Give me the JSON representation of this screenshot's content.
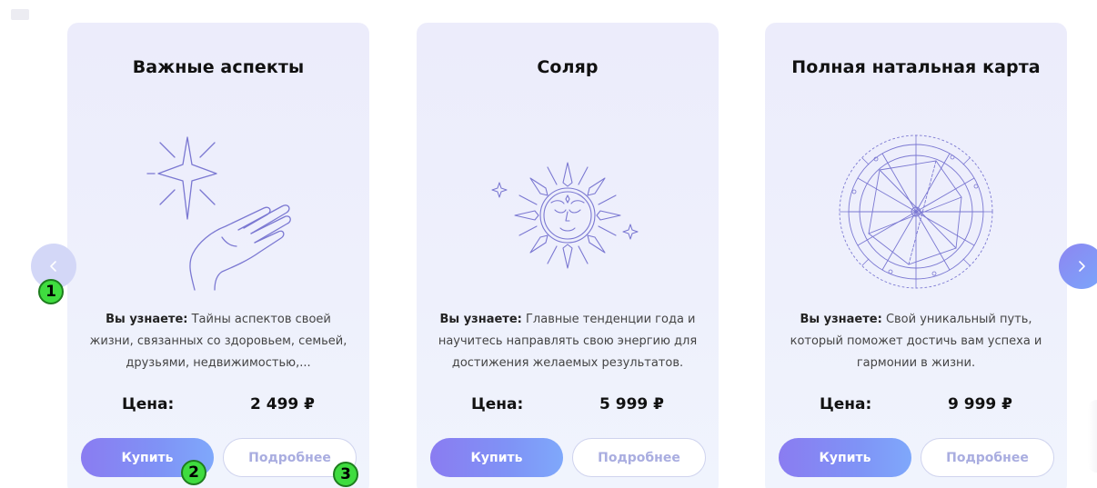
{
  "cards": [
    {
      "title": "Важные аспекты",
      "illustration": "star-hand-icon",
      "desc_lead": "Вы узнаете:",
      "desc_text": "Тайны аспектов своей жизни, связанных со здоровьем, семьей, друзьями, недвижимостью,...",
      "price_label": "Цена:",
      "price_value": "2 499 ₽",
      "buy_label": "Купить",
      "more_label": "Подробнее"
    },
    {
      "title": "Соляр",
      "illustration": "sun-face-icon",
      "desc_lead": "Вы узнаете:",
      "desc_text": "Главные тенденции года и научитесь направлять свою энергию для достижения желаемых результатов.",
      "price_label": "Цена:",
      "price_value": "5 999 ₽",
      "buy_label": "Купить",
      "more_label": "Подробнее"
    },
    {
      "title": "Полная натальная карта",
      "illustration": "natal-chart-icon",
      "desc_lead": "Вы узнаете:",
      "desc_text": "Свой уникальный путь, который поможет достичь вам успеха и гармонии в жизни.",
      "price_label": "Цена:",
      "price_value": "9 999 ₽",
      "buy_label": "Купить",
      "more_label": "Подробнее"
    }
  ],
  "navigation": {
    "prev_icon": "chevron-left-icon",
    "next_icon": "chevron-right-icon"
  },
  "markers": [
    "1",
    "2",
    "3"
  ],
  "colors": {
    "accent_start": "#8a7cf1",
    "accent_end": "#7fa8fb",
    "line_art": "#7b78d2",
    "marker": "#3fdc3f"
  }
}
